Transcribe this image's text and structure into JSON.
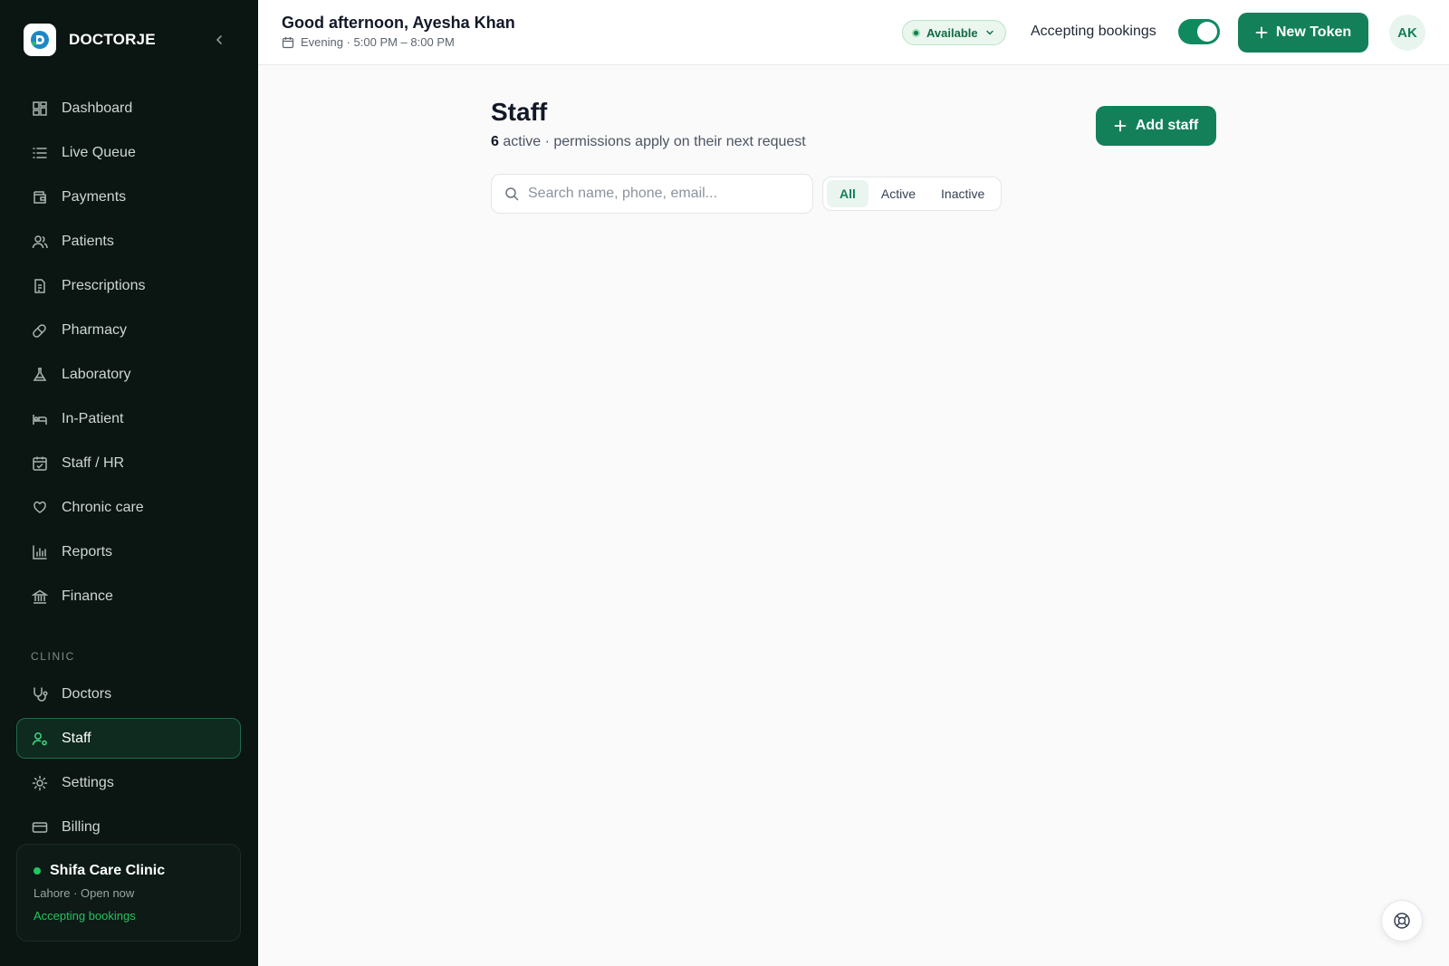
{
  "brand": {
    "name": "DOCTORJE"
  },
  "sidebar": {
    "items": [
      {
        "label": "Dashboard",
        "icon": "dashboard-icon"
      },
      {
        "label": "Live Queue",
        "icon": "list-icon"
      },
      {
        "label": "Payments",
        "icon": "wallet-icon"
      },
      {
        "label": "Patients",
        "icon": "users-icon"
      },
      {
        "label": "Prescriptions",
        "icon": "document-icon"
      },
      {
        "label": "Pharmacy",
        "icon": "pill-icon"
      },
      {
        "label": "Laboratory",
        "icon": "flask-icon"
      },
      {
        "label": "In-Patient",
        "icon": "bed-icon"
      },
      {
        "label": "Staff / HR",
        "icon": "calendar-check-icon"
      },
      {
        "label": "Chronic care",
        "icon": "heart-hand-icon"
      },
      {
        "label": "Reports",
        "icon": "bar-chart-icon"
      },
      {
        "label": "Finance",
        "icon": "bank-icon"
      }
    ],
    "section_label": "CLINIC",
    "clinic_items": [
      {
        "label": "Doctors",
        "icon": "stethoscope-icon"
      },
      {
        "label": "Staff",
        "icon": "user-cog-icon",
        "active": true
      },
      {
        "label": "Settings",
        "icon": "gear-icon"
      },
      {
        "label": "Billing",
        "icon": "credit-card-icon"
      }
    ],
    "clinic_card": {
      "name": "Shifa Care Clinic",
      "meta": "Lahore · Open now",
      "status": "Accepting bookings"
    }
  },
  "header": {
    "greeting": "Good afternoon, Ayesha Khan",
    "session": "Evening · 5:00 PM – 8:00 PM",
    "availability": "Available",
    "accepting_label": "Accepting bookings",
    "accepting_on": true,
    "new_token_label": "New Token",
    "avatar_initials": "AK"
  },
  "main": {
    "title": "Staff",
    "active_count": "6",
    "subtitle": "active · permissions apply on their next request",
    "add_staff_label": "Add staff",
    "search": {
      "placeholder": "Search name, phone, email...",
      "value": ""
    },
    "filters": [
      "All",
      "Active",
      "Inactive"
    ],
    "selected_filter": "All"
  },
  "colors": {
    "brand_green": "#13805a",
    "sidebar_bg": "#0b1512",
    "status_green": "#22c55e"
  }
}
